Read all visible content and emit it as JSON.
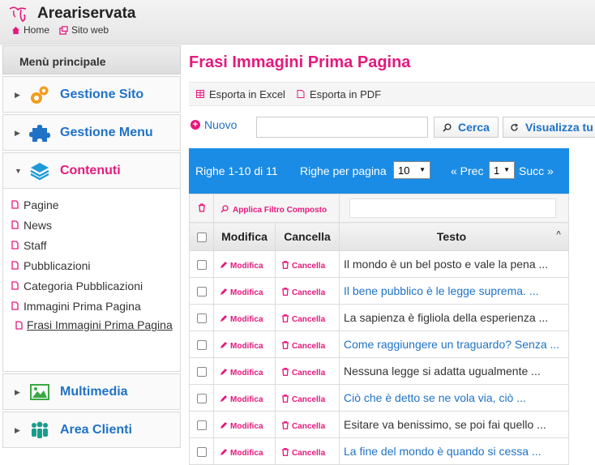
{
  "app": {
    "title": "Areariservata",
    "nav": [
      {
        "label": "Home",
        "icon": "home-icon"
      },
      {
        "label": "Sito web",
        "icon": "external-link-icon"
      }
    ]
  },
  "sidebar": {
    "header": "Menù principale",
    "sections_top": [
      {
        "label": "Gestione Sito",
        "icon": "gears-icon"
      },
      {
        "label": "Gestione Menu",
        "icon": "puzzle-icon"
      },
      {
        "label": "Contenuti",
        "icon": "layers-icon",
        "open": true
      }
    ],
    "content_items": [
      "Pagine",
      "News",
      "Staff",
      "Pubblicazioni",
      "Categoria Pubblicazioni",
      "Immagini Prima Pagina",
      "Frasi Immagini Prima Pagina"
    ],
    "sections_bottom": [
      {
        "label": "Multimedia",
        "icon": "image-icon"
      },
      {
        "label": "Area Clienti",
        "icon": "users-icon"
      }
    ]
  },
  "main": {
    "title": "Frasi Immagini Prima Pagina",
    "export_excel": "Esporta in Excel",
    "export_pdf": "Esporta in PDF",
    "new_label": "Nuovo",
    "search_value": "",
    "search_label": "Cerca",
    "view_all_label": "Visualizza tu"
  },
  "pager": {
    "rows_info": "Righe 1-10 di 11",
    "per_page_label": "Righe per pagina",
    "per_page_value": "10",
    "prev_label": "« Prec",
    "page_value": "1",
    "next_label": "Succ »"
  },
  "grid": {
    "filter_apply": "Applica Filtro Composto",
    "columns": [
      "Modifica",
      "Cancella",
      "Testo"
    ],
    "edit_label": "Modifica",
    "delete_label": "Cancella",
    "rows": [
      {
        "text": "Il mondo è un bel posto e vale la pena ...",
        "link": false
      },
      {
        "text": "Il bene pubblico è le legge suprema. ...",
        "link": true
      },
      {
        "text": "La sapienza è figliola della esperienza ...",
        "link": false
      },
      {
        "text": "Come raggiungere un traguardo? Senza ...",
        "link": true
      },
      {
        "text": "Nessuna legge si adatta ugualmente ...",
        "link": false
      },
      {
        "text": "Ciò che è detto se ne vola via, ciò ...",
        "link": true
      },
      {
        "text": "Esitare va benissimo, se poi fai quello ...",
        "link": false
      },
      {
        "text": "La fine del mondo è quando si cessa ...",
        "link": true
      }
    ]
  },
  "colors": {
    "accent": "#e5197d",
    "link": "#1f72c6",
    "pager": "#1a8ce5"
  }
}
